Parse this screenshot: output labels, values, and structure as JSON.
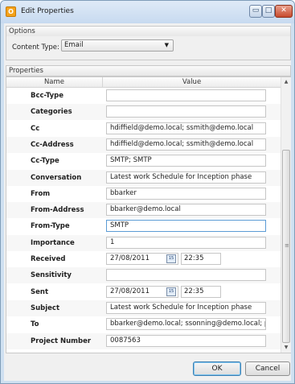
{
  "window": {
    "title": "Edit Properties",
    "app_icon_glyph": "O",
    "min_glyph": "▭",
    "max_glyph": "□",
    "close_glyph": "✕"
  },
  "options": {
    "header": "Options",
    "content_type_label": "Content Type:",
    "content_type_value": "Email",
    "dropdown_glyph": "▼"
  },
  "properties": {
    "header": "Properties",
    "col_name": "Name",
    "col_value": "Value",
    "rows": [
      {
        "name": "Bcc-Type",
        "value": ""
      },
      {
        "name": "Categories",
        "value": ""
      },
      {
        "name": "Cc",
        "value": "hdiffield@demo.local; ssmith@demo.local"
      },
      {
        "name": "Cc-Address",
        "value": "hdiffield@demo.local; ssmith@demo.local"
      },
      {
        "name": "Cc-Type",
        "value": "SMTP; SMTP"
      },
      {
        "name": "Conversation",
        "value": "Latest work Schedule for Inception phase"
      },
      {
        "name": "From",
        "value": "bbarker"
      },
      {
        "name": "From-Address",
        "value": "bbarker@demo.local"
      },
      {
        "name": "From-Type",
        "value": "SMTP"
      },
      {
        "name": "Importance",
        "value": "1"
      },
      {
        "name": "Received",
        "date": "27/08/2011",
        "time": "22:35"
      },
      {
        "name": "Sensitivity",
        "value": ""
      },
      {
        "name": "Sent",
        "date": "27/08/2011",
        "time": "22:35"
      },
      {
        "name": "Subject",
        "value": "Latest work Schedule for Inception phase"
      },
      {
        "name": "To",
        "value": "bbarker@demo.local; ssonning@demo.local; pjones@"
      },
      {
        "name": "Project Number",
        "value": "0087563"
      }
    ],
    "calendar_glyph": "15",
    "scroll_up_glyph": "▲",
    "scroll_down_glyph": "▼",
    "scroll_grip_glyph": "≡"
  },
  "buttons": {
    "ok": "OK",
    "cancel": "Cancel"
  }
}
